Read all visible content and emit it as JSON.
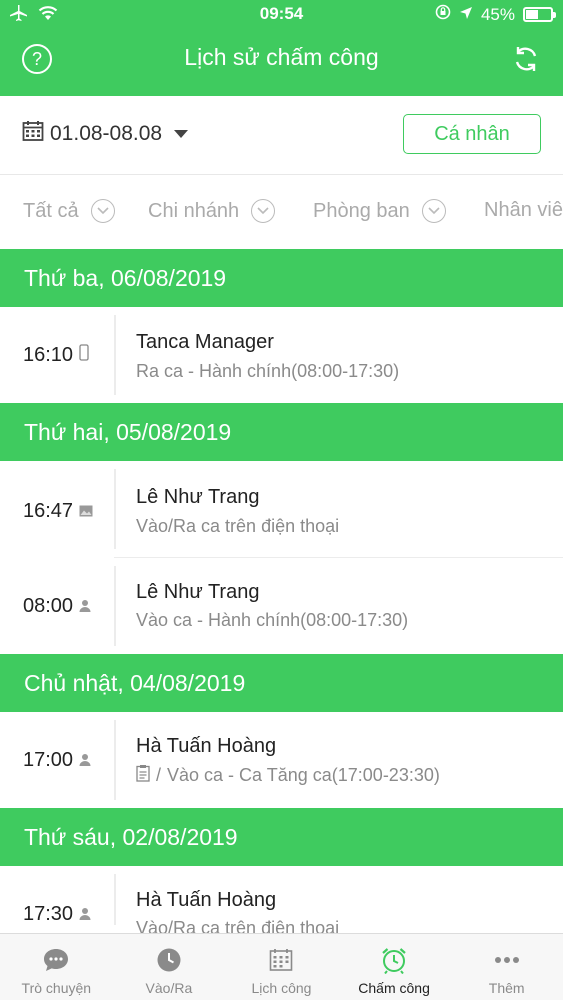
{
  "status_bar": {
    "time": "09:54",
    "battery": "45%"
  },
  "header": {
    "title": "Lịch sử chấm công",
    "help_label": "?"
  },
  "filters": {
    "date_range": "01.08-08.08",
    "personal_button": "Cá nhân",
    "options": [
      "Tất cả",
      "Chi nhánh",
      "Phòng ban",
      "Nhân viên"
    ]
  },
  "days": [
    {
      "label": "Thứ ba, 06/08/2019",
      "entries": [
        {
          "time": "16:10",
          "icon": "phone-icon",
          "name": "Tanca Manager",
          "detail": "Ra ca - Hành chính(08:00-17:30)"
        }
      ]
    },
    {
      "label": "Thứ hai, 05/08/2019",
      "entries": [
        {
          "time": "16:47",
          "icon": "image-icon",
          "name": "Lê Như Trang",
          "detail": "Vào/Ra ca trên điện thoại"
        },
        {
          "time": "08:00",
          "icon": "person-icon",
          "name": "Lê Như Trang",
          "detail": "Vào ca - Hành chính(08:00-17:30)"
        }
      ]
    },
    {
      "label": "Chủ nhật, 04/08/2019",
      "entries": [
        {
          "time": "17:00",
          "icon": "person-icon",
          "name": "Hà Tuấn Hoàng",
          "detail_prefix": "/",
          "detail": "Vào ca - Ca Tăng ca(17:00-23:30)"
        }
      ]
    },
    {
      "label": "Thứ sáu, 02/08/2019",
      "entries": [
        {
          "time": "17:30",
          "icon": "person-icon",
          "name": "Hà Tuấn Hoàng",
          "detail": "Vào/Ra ca trên điện thoại"
        }
      ]
    }
  ],
  "tabbar": [
    {
      "label": "Trò chuyện",
      "icon": "chat-icon"
    },
    {
      "label": "Vào/Ra",
      "icon": "clock-icon"
    },
    {
      "label": "Lịch công",
      "icon": "calendar-icon"
    },
    {
      "label": "Chấm công",
      "icon": "alarm-icon",
      "active": true
    },
    {
      "label": "Thêm",
      "icon": "more-icon"
    }
  ],
  "colors": {
    "brand": "#3fcb5f"
  }
}
